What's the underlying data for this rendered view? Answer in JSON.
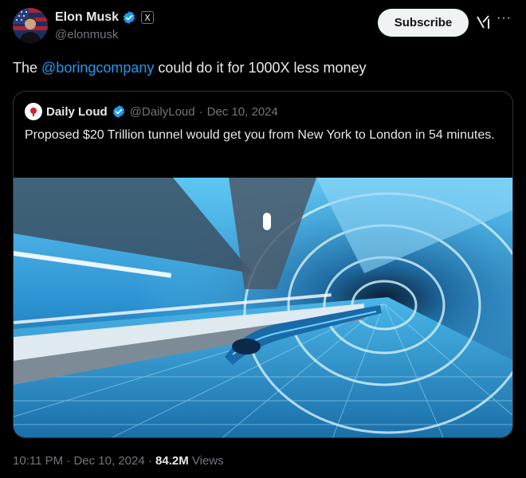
{
  "author": {
    "display_name": "Elon Musk",
    "handle": "@elonmusk",
    "affiliation_badge": "X"
  },
  "actions": {
    "subscribe_label": "Subscribe",
    "grok_icon": "grok-icon",
    "more_icon": "more-icon"
  },
  "tweet": {
    "text_before": "The ",
    "mention": "@boringcompany",
    "text_after": " could do it for 1000X less money"
  },
  "quote": {
    "display_name": "Daily Loud",
    "handle": "@DailyLoud",
    "separator": " · ",
    "date": "Dec 10, 2024",
    "text": "Proposed $20 Trillion tunnel would get you from New York to London in 54 minutes."
  },
  "footer": {
    "time": "10:11 PM",
    "separator1": " · ",
    "date": "Dec 10, 2024",
    "separator2": " · ",
    "views_count": "84.2M",
    "views_label": " Views"
  },
  "colors": {
    "background": "#000000",
    "accent": "#1d9bf0",
    "muted": "#71767b",
    "text": "#e7e9ea"
  }
}
